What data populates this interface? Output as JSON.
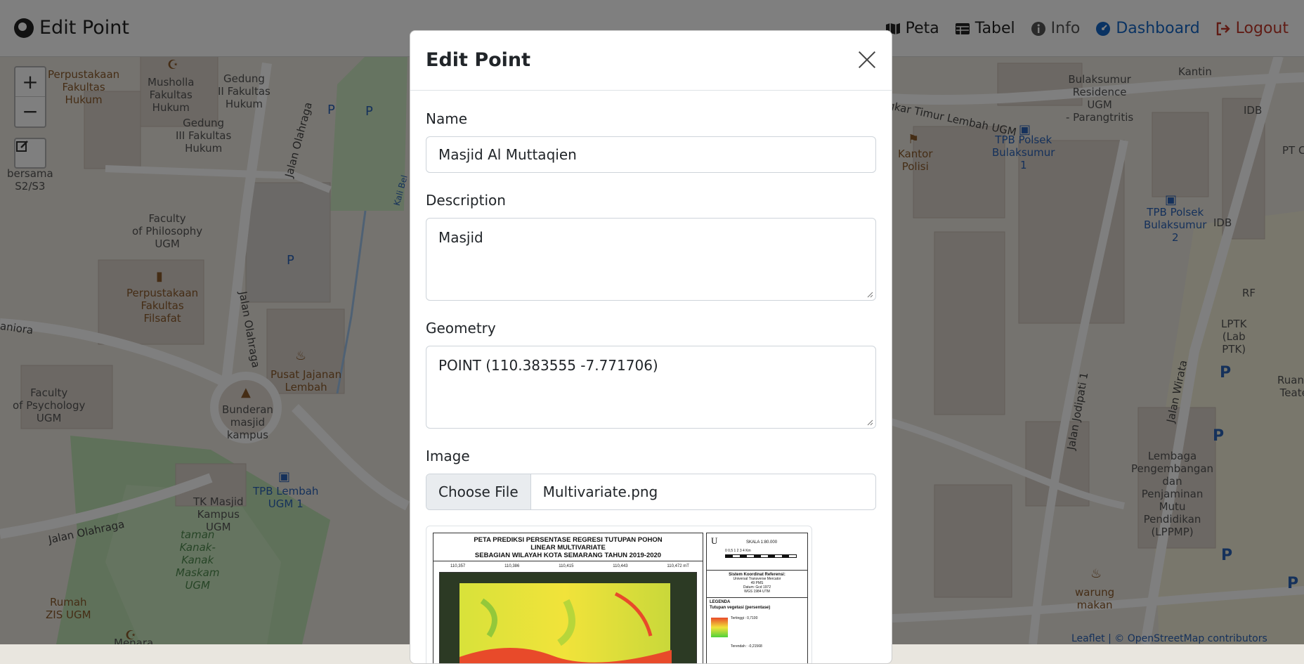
{
  "navbar": {
    "brand": "Edit Point",
    "items": [
      {
        "label": "Peta",
        "icon": "map-icon"
      },
      {
        "label": "Tabel",
        "icon": "table-icon"
      },
      {
        "label": "Info",
        "icon": "info-icon"
      },
      {
        "label": "Dashboard",
        "icon": "dashboard-icon"
      },
      {
        "label": "Logout",
        "icon": "logout-icon"
      }
    ]
  },
  "map": {
    "zoom_in": "+",
    "zoom_out": "−",
    "labels": {
      "perpus_hukum": "Perpustakaan\nFakultas\nHukum",
      "musholla": "Musholla\nFakultas\nHukum",
      "gedung2": "Gedung\nII Fakultas\nHukum",
      "gedung3": "Gedung\nIII Fakultas\nHukum",
      "philosophy": "Faculty\nof Philosophy\nUGM",
      "perpus_filsafat": "Perpustakaan\nFakultas\nFilsafat",
      "psychology": "Faculty\nof Psychology\nUGM",
      "pusat_jajanan": "Pusat Jajanan\nLembah",
      "bunderan": "Bunderan\nmasjid\nkampus",
      "tpb_lembah": "TPB Lembah\nUGM 1",
      "tk_masjid": "TK Masjid\nKampus\nUGM",
      "taman": "taman\nKanak-\nKanak\nMaskam\nUGM",
      "rumah": "Rumah\nZIS UGM",
      "bersama": "bersama\nS2/S3",
      "residence": "Bulaksumur\nResidence\nUGM\n- Parangtritis",
      "kantin": "Kantin",
      "kantor_polisi": "Kantor\nPolisi",
      "tpb_polsek1": "TPB Polsek\nBulaksumur\n1",
      "tpb_polsek2": "TPB Polsek\nBulaksumur\n2",
      "idb1": "IDB",
      "idb2": "IDB",
      "ptc": "PT C",
      "rf": "RF",
      "lptk": "LPTK\n(Lab\nPTK)",
      "ruang": "Ruang\nTeate",
      "lembaga": "Lembaga\nPengembangan\ndan\nPenjaminan\nMutu\nPendidikan\n(LPPMP)",
      "warung": "warung\nmakan",
      "menara": "Menara",
      "road_olahraga1": "Jalan Olahraga",
      "road_olahraga2": "Jalan Olahraga",
      "road_olahraga3": "Jalan Olahraga",
      "road_lingkar": "gkar Timur Lembah UGM",
      "road_jodipati": "Jalan Jodipati 1",
      "road_wirata": "Jalan Wirata",
      "road_aniora": "aniora",
      "road_kali": "Kali Bel",
      "attribution": "Leaflet | © OpenStreetMap contributors"
    }
  },
  "modal": {
    "title": "Edit Point",
    "name_label": "Name",
    "name_value": "Masjid Al Muttaqien",
    "description_label": "Description",
    "description_value": "Masjid",
    "geometry_label": "Geometry",
    "geometry_value": "POINT (110.383555 -7.771706)",
    "image_label": "Image",
    "choose_file": "Choose File",
    "file_name": "Multivariate.png",
    "preview": {
      "title_line1": "PETA PREDIKSI PERSENTASE REGRESI TUTUPAN POHON",
      "title_line2": "LINEAR MULTIVARIATE",
      "title_line3": "SEBAGIAN WILAYAH KOTA SEMARANG TAHUN 2019-2020",
      "ticks": [
        "110,357",
        "110,386",
        "110,415",
        "110,443",
        "110,472 mT"
      ],
      "skala": "SKALA 1:80.000",
      "north": "U",
      "scale_nums": "0 0,5 1 2 3 4 Km",
      "sistem": "Sistem Koordinat Referensi:",
      "sistem_detail": "Universal Transverse Mercator\n49 PMS\nDatum: Gcd 1972\nWGS 1984 UTM",
      "legenda": "LEGENDA",
      "legend_sub": "Tutupan vegetasi (persentase)",
      "tertinggi": "Tertinggi : 0,7100",
      "terendah": "Terendah : -0,21568"
    }
  }
}
